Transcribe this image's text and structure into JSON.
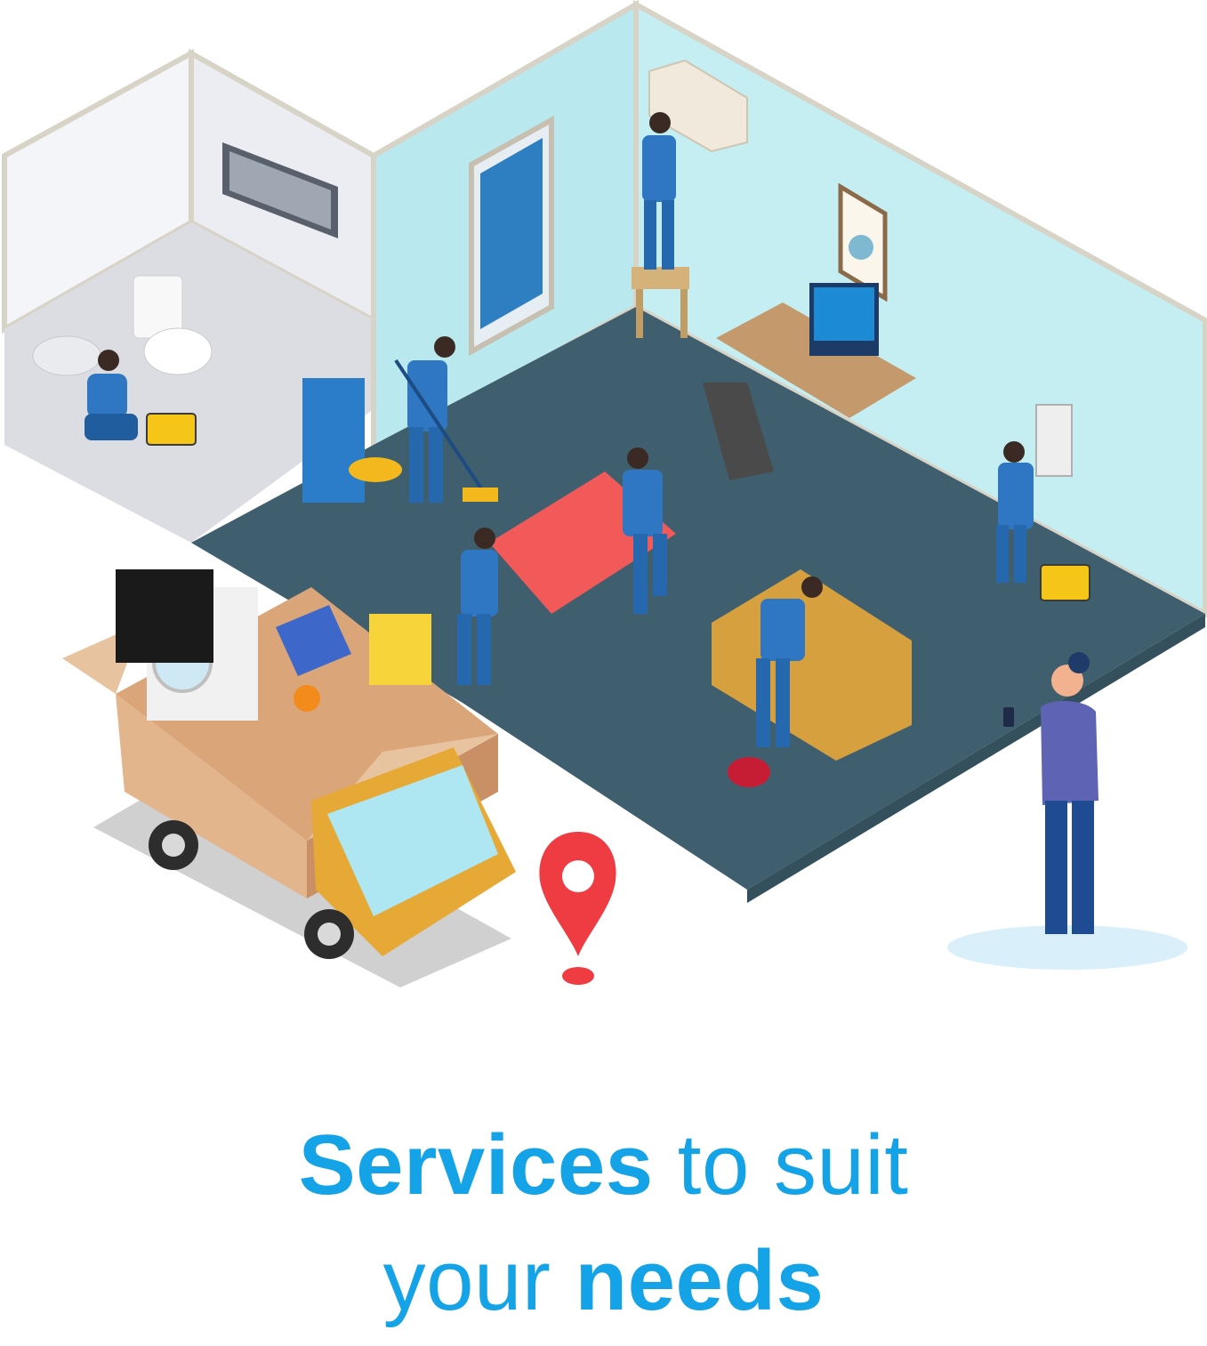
{
  "headline": {
    "line1_bold": "Services",
    "line1_rest": " to suit",
    "line2_rest": "your ",
    "line2_bold": "needs"
  },
  "colors": {
    "accent": "#14a3e6",
    "wall": "#b9e8ee",
    "floor": "#405f6e",
    "worker": "#2f77c2",
    "pin": "#ef3b42"
  },
  "icons": [
    "map-pin-icon"
  ]
}
